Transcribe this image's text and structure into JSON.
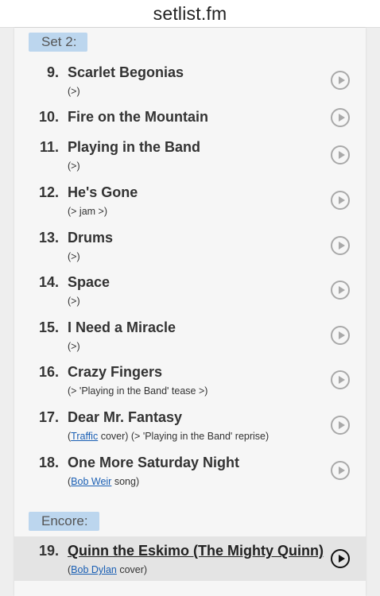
{
  "header": {
    "title": "setlist.fm"
  },
  "sets": [
    {
      "label": "Set 2:"
    },
    {
      "label": "Encore:"
    }
  ],
  "songs": [
    {
      "num": "9.",
      "name": "Scarlet Begonias",
      "note": "(>)"
    },
    {
      "num": "10.",
      "name": "Fire on the Mountain",
      "note": ""
    },
    {
      "num": "11.",
      "name": "Playing in the Band",
      "note": "(>)"
    },
    {
      "num": "12.",
      "name": "He's Gone",
      "note": "(> jam >)"
    },
    {
      "num": "13.",
      "name": "Drums",
      "note": "(>)"
    },
    {
      "num": "14.",
      "name": "Space",
      "note": "(>)"
    },
    {
      "num": "15.",
      "name": "I Need a Miracle",
      "note": "(>)"
    },
    {
      "num": "16.",
      "name": "Crazy Fingers",
      "note": "(> 'Playing in the Band' tease >)"
    },
    {
      "num": "17.",
      "name": "Dear Mr. Fantasy",
      "note_pre": "(",
      "note_link": "Traffic",
      "note_post": " cover) (> 'Playing in the Band' reprise)"
    },
    {
      "num": "18.",
      "name": "One More Saturday Night",
      "note_pre": "(",
      "note_link": "Bob Weir",
      "note_post": " song)"
    },
    {
      "num": "19.",
      "name": "Quinn the Eskimo (The Mighty Quinn)",
      "note_pre": "(",
      "note_link": "Bob Dylan",
      "note_post": " cover)"
    }
  ],
  "colors": {
    "set_label_bg": "#bcd6ee",
    "link": "#1a5fb4",
    "highlight_row": "#e4e4e4"
  },
  "icons": {
    "play": "play-circle-icon"
  }
}
